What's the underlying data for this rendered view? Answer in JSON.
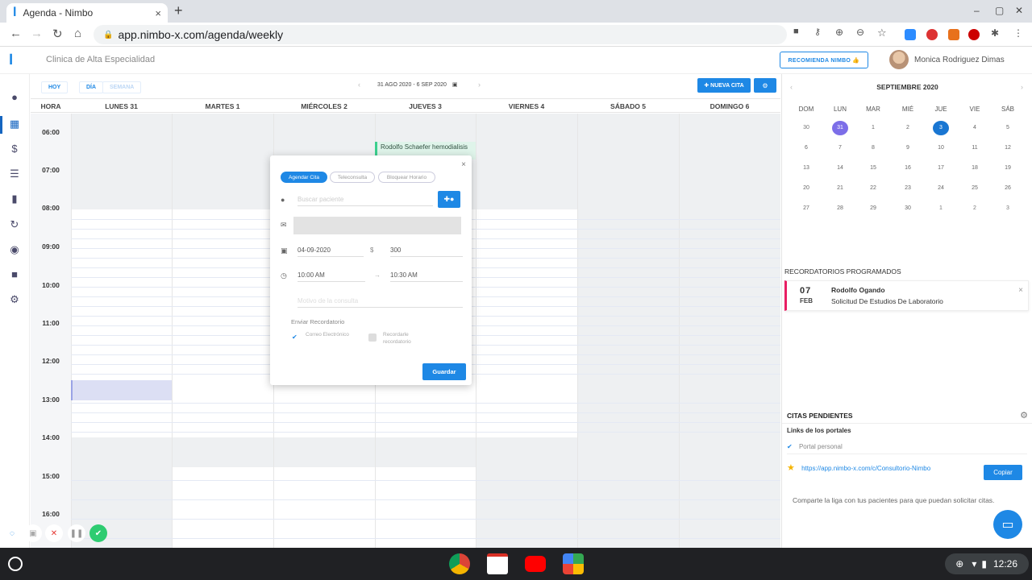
{
  "browser": {
    "tab_title": "Agenda - Nimbo",
    "tab_close": "×",
    "new_tab": "+",
    "url": "app.nimbo-x.com/agenda/weekly",
    "window_controls": [
      "–",
      "▢",
      "✕"
    ]
  },
  "header": {
    "clinic_name": "Clinica de Alta Especialidad",
    "recommend_label": "RECOMIENDA NIMBO 👍",
    "user_name": "Monica Rodriguez Dimas"
  },
  "toolbar": {
    "today": "HOY",
    "day": "DÍA",
    "week": "SEMANA",
    "date_range": "31 AGO 2020 - 6 SEP 2020",
    "new_appointment": "✚ NUEVA CITA",
    "settings": "⚙"
  },
  "calendar": {
    "hour_header": "HORA",
    "days": [
      "LUNES 31",
      "MARTES 1",
      "MIÉRCOLES 2",
      "JUEVES 3",
      "VIERNES 4",
      "SÁBADO 5",
      "DOMINGO 6"
    ],
    "hours": [
      "06:00",
      "07:00",
      "08:00",
      "09:00",
      "10:00",
      "11:00",
      "12:00",
      "13:00",
      "14:00",
      "15:00",
      "16:00"
    ],
    "event": "Rodolfo Schaefer hemodialisis"
  },
  "modal": {
    "close": "×",
    "tabs": [
      "Agendar Cita",
      "Teleconsulta",
      "Bloquear Horario"
    ],
    "patient_placeholder": "Buscar paciente",
    "date": "04-09-2020",
    "currency": "$",
    "price": "300",
    "start_time": "10:00 AM",
    "end_time": "10:30 AM",
    "reason_placeholder": "Motivo de la consulta",
    "reminder_label": "Enviar Recordatorio",
    "option_email": "Correo Electrónico",
    "option_reminder": "Recordarle recordatorio",
    "save": "Guardar"
  },
  "minical": {
    "month": "SEPTIEMBRE 2020",
    "weekdays": [
      "DOM",
      "LUN",
      "MAR",
      "MIÉ",
      "JUE",
      "VIE",
      "SÁB"
    ],
    "weeks": [
      [
        "30",
        "31",
        "1",
        "2",
        "3",
        "4",
        "5"
      ],
      [
        "6",
        "7",
        "8",
        "9",
        "10",
        "11",
        "12"
      ],
      [
        "13",
        "14",
        "15",
        "16",
        "17",
        "18",
        "19"
      ],
      [
        "20",
        "21",
        "22",
        "23",
        "24",
        "25",
        "26"
      ],
      [
        "27",
        "28",
        "29",
        "30",
        "1",
        "2",
        "3"
      ]
    ]
  },
  "reminders": {
    "title": "RECORDATORIOS PROGRAMADOS",
    "day": "07",
    "month": "FEB",
    "name": "Rodolfo Ogando",
    "description": "Solicitud De Estudios De Laboratorio",
    "close": "×"
  },
  "pending": {
    "title": "CITAS PENDIENTES",
    "links_title": "Links de los portales",
    "portal": "Portal personal",
    "link": "https://app.nimbo-x.com/c/Consultorio-Nimbo",
    "copy": "Copiar",
    "share_text": "Comparte la liga con tus pacientes para que puedan solicitar citas."
  },
  "taskbar": {
    "time": "12:26"
  },
  "colors": {
    "accent": "#1e88e5",
    "purple_day": "#7c6ee8",
    "event_green": "#3ccf8e",
    "reminder_pink": "#e91e63"
  }
}
